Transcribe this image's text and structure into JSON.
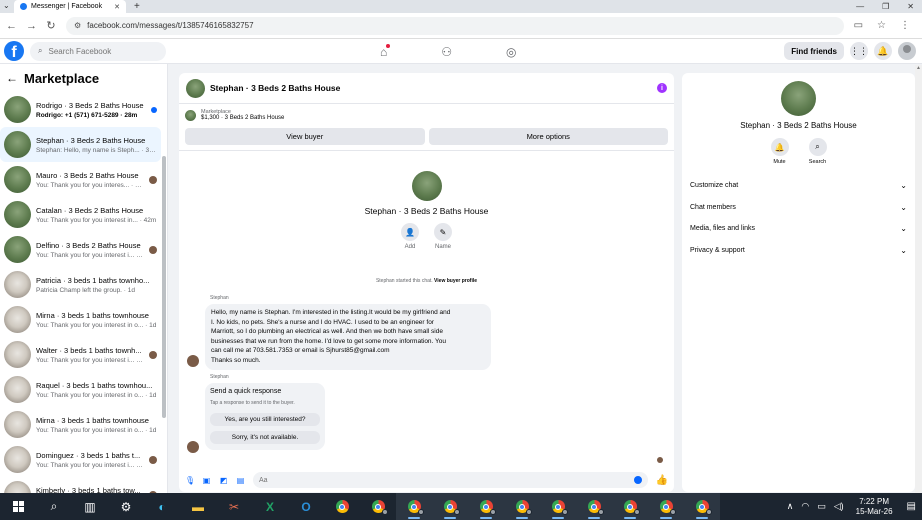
{
  "browser": {
    "tab_title": "Messenger | Facebook",
    "url": "facebook.com/messages/t/1385746165832757"
  },
  "header": {
    "search_placeholder": "Search Facebook",
    "find_friends": "Find friends"
  },
  "sidebar": {
    "title": "Marketplace",
    "conversations": [
      {
        "name": "Rodrigo · 3 Beds 2 Baths House",
        "preview": "Rodrigo: +1 (571) 671-5289 · 28m",
        "thumb": "house",
        "unread": true,
        "seen": false
      },
      {
        "name": "Stephan · 3 Beds 2 Baths House",
        "preview": "Stephan: Hello, my name is Steph... · 36m",
        "thumb": "house",
        "active": true,
        "seen": false
      },
      {
        "name": "Mauro · 3 Beds 2 Baths House",
        "preview": "You: Thank you for you interes... · 42m",
        "thumb": "house",
        "seen": true
      },
      {
        "name": "Catalan · 3 Beds 2 Baths House",
        "preview": "You: Thank you for you interest in... · 42m",
        "thumb": "house",
        "seen": false
      },
      {
        "name": "Delfino · 3 Beds 2 Baths House",
        "preview": "You: Thank you for you interest i... · 3h",
        "thumb": "house",
        "seen": true
      },
      {
        "name": "Patricia · 3 beds 1 baths townho...",
        "preview": "Patricia Champ left the group. · 1d",
        "thumb": "town",
        "seen": false
      },
      {
        "name": "Mirna · 3 beds 1 baths townhouse",
        "preview": "You: Thank you for you interest in o... · 1d",
        "thumb": "town",
        "seen": false
      },
      {
        "name": "Walter · 3 beds 1 baths townh...",
        "preview": "You: Thank you for you interest i... · 1d",
        "thumb": "town",
        "seen": true
      },
      {
        "name": "Raquel · 3 beds 1 baths townhou...",
        "preview": "You: Thank you for you interest in o... · 1d",
        "thumb": "town",
        "seen": false
      },
      {
        "name": "Mirna · 3 beds 1 baths townhouse",
        "preview": "You: Thank you for you interest in o... · 1d",
        "thumb": "town",
        "seen": false
      },
      {
        "name": "Dominguez · 3 beds 1 baths t...",
        "preview": "You: Thank you for you interest i... · 1d",
        "thumb": "town",
        "seen": true
      },
      {
        "name": "Kimberly · 3 beds 1 baths tow...",
        "preview": "You: Thank you for you interest i... · 1d",
        "thumb": "town",
        "seen": true
      }
    ]
  },
  "chat": {
    "title": "Stephan · 3 Beds 2 Baths House",
    "listing_label": "Marketplace",
    "listing_detail": "$1,300 · 3 Beds 2 Baths House",
    "view_buyer": "View buyer",
    "more_options": "More options",
    "profile_name": "Stephan · 3 Beds 2 Baths House",
    "add_label": "Add",
    "name_label": "Name",
    "system_msg": "Stephan started this chat.",
    "system_link": "View buyer profile",
    "sender": "Stephan",
    "message_lines": [
      "Hello, my name is Stephan. I'm interested in the listing.It would be my girlfriend and",
      "I. No kids, no pets. She's a nurse and I do HVAC. I used to be an engineer for",
      "Marriott, so I do plumbing an electrical as well. And then we both have small side",
      "businesses that we run from the home. I'd love to get some more information. You",
      "can call me at 703.581.7353 or email is Sjhurst85@gmail.com",
      "Thanks so much."
    ],
    "quick_reply_title": "Send a quick response",
    "quick_reply_sub": "Tap a response to send it to the buyer.",
    "quick_reply_1": "Yes, are you still interested?",
    "quick_reply_2": "Sorry, it's not available.",
    "composer_placeholder": "Aa"
  },
  "details": {
    "name": "Stephan · 3 Beds 2 Baths House",
    "mute": "Mute",
    "search": "Search",
    "menu": [
      "Customize chat",
      "Chat members",
      "Media, files and links",
      "Privacy & support"
    ]
  },
  "taskbar": {
    "time": "7:22 PM",
    "date": "15-Mar-26"
  },
  "colors": {
    "brand": "#1877f2",
    "messenger_blue": "#0866ff",
    "active_row": "#ebf5ff"
  }
}
